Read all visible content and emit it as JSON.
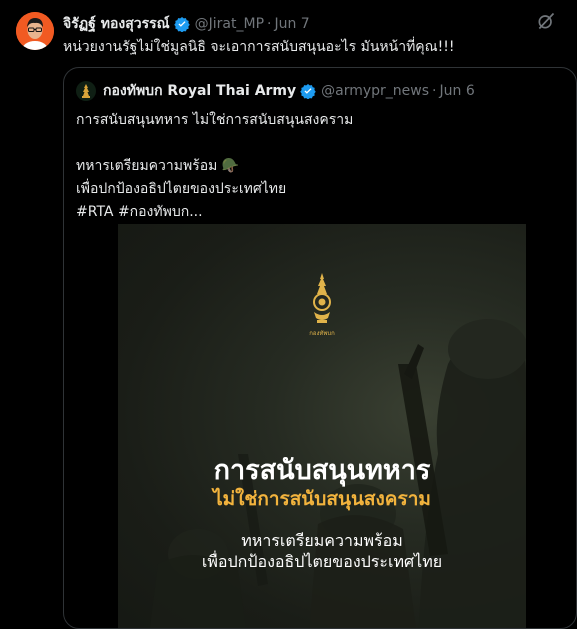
{
  "tweet": {
    "author_name": "จิรัฏฐ์ ทองสุวรรณ์",
    "handle": "@Jirat_MP",
    "separator": "·",
    "date": "Jun 7",
    "text": "หน่วยงานรัฐไม่ใช่มูลนิธิ จะเอาการสนับสนุนอะไร มันหน้าที่คุณ!!!"
  },
  "quoted": {
    "author_name": "กองทัพบก Royal Thai Army",
    "handle": "@armypr_news",
    "separator": "·",
    "date": "Jun 6",
    "line1": "การสนับสนุนทหาร ไม่ใช่การสนับสนุนสงคราม",
    "line2": "ทหารเตรียมความพร้อม 🪖",
    "line3": "เพื่อปกป้องอธิปไตยของประเทศไทย",
    "hashtag1": "#RTA",
    "hashtag2": "#กองทัพบก...",
    "media": {
      "emblem_label": "กองทัพบก",
      "title": "การสนับสนุนทหาร",
      "subtitle": "ไม่ใช่การสนับสนุนสงคราม",
      "line3": "ทหารเตรียมความพร้อม",
      "line4": "เพื่อปกป้องอธิปไตยของประเทศไทย"
    }
  },
  "icons": {
    "verified": "verified-badge-icon",
    "grok": "grok-icon",
    "emblem": "royal-thai-army-emblem-icon"
  },
  "colors": {
    "background": "#000000",
    "text": "#e7e9ea",
    "muted": "#71767b",
    "verified": "#1d9bf0",
    "accent_gold": "#f2b33d"
  }
}
